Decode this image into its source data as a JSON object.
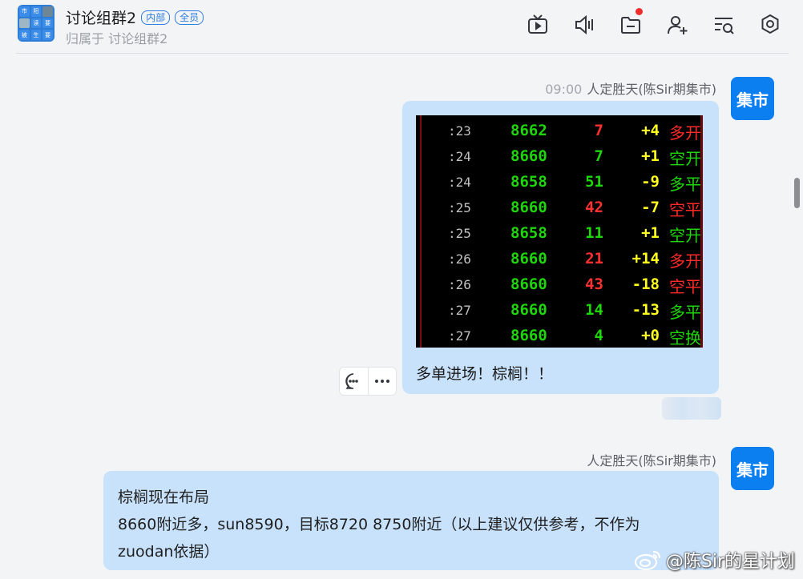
{
  "header": {
    "group_avatar_cells": [
      "市",
      "阳",
      "",
      "",
      "读",
      "要",
      "被",
      "生",
      "要"
    ],
    "title": "讨论组群2",
    "tags": [
      "内部",
      "全员"
    ],
    "subtitle": "归属于 讨论组群2"
  },
  "toolbar": {
    "icons": [
      "tv-icon",
      "speaker-icon",
      "folder-icon",
      "add-member-icon",
      "search-list-icon",
      "settings-icon"
    ],
    "folder_has_notification": true
  },
  "messages": [
    {
      "time": "09:00",
      "sender": "人定胜天(陈Sir期集市)",
      "avatar_text": "集市",
      "image": {
        "rows": [
          {
            "time": ":23",
            "price": "8662",
            "volume": "7",
            "volume_color": "#ff3030",
            "change": "+4",
            "type": "多开",
            "type_color": "#ff2a2a"
          },
          {
            "time": ":24",
            "price": "8660",
            "volume": "7",
            "volume_color": "#1ed60a",
            "change": "+1",
            "type": "空开",
            "type_color": "#1ed60a"
          },
          {
            "time": ":24",
            "price": "8658",
            "volume": "51",
            "volume_color": "#1ed60a",
            "change": "-9",
            "type": "多平",
            "type_color": "#1ed60a"
          },
          {
            "time": ":25",
            "price": "8660",
            "volume": "42",
            "volume_color": "#ff3030",
            "change": "-7",
            "type": "空平",
            "type_color": "#ff2a2a"
          },
          {
            "time": ":25",
            "price": "8658",
            "volume": "11",
            "volume_color": "#1ed60a",
            "change": "+1",
            "type": "空开",
            "type_color": "#1ed60a"
          },
          {
            "time": ":26",
            "price": "8660",
            "volume": "21",
            "volume_color": "#ff3030",
            "change": "+14",
            "type": "多开",
            "type_color": "#ff2a2a"
          },
          {
            "time": ":26",
            "price": "8660",
            "volume": "43",
            "volume_color": "#ff3030",
            "change": "-18",
            "type": "空平",
            "type_color": "#ff2a2a"
          },
          {
            "time": ":27",
            "price": "8660",
            "volume": "14",
            "volume_color": "#1ed60a",
            "change": "-13",
            "type": "多平",
            "type_color": "#1ed60a"
          },
          {
            "time": ":27",
            "price": "8660",
            "volume": "4",
            "volume_color": "#1ed60a",
            "change": "+0",
            "type": "空换",
            "type_color": "#1ed60a"
          }
        ]
      },
      "text": "多单进场！棕榈！！"
    },
    {
      "time": "",
      "sender": "人定胜天(陈Sir期集市)",
      "avatar_text": "集市",
      "lines": [
        "棕榈现在布局",
        "8660附近多，sun8590，目标8720 8750附近（以上建议仅供参考，不作为",
        "zuodan依据）"
      ]
    }
  ],
  "watermark": "@陈Sir的星计划",
  "colors": {
    "accent": "#2e7de0",
    "bubble": "#c8e2fc",
    "avatar": "#0b7ef0",
    "notification": "#f02d2d"
  }
}
